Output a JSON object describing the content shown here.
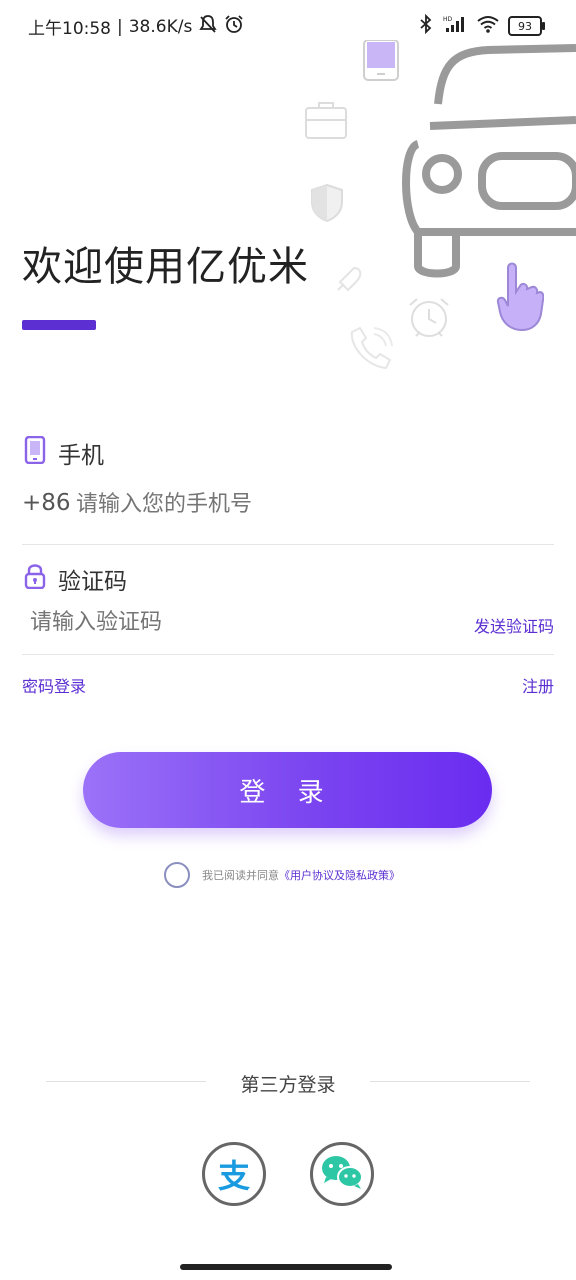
{
  "status_bar": {
    "time": "上午10:58",
    "separator": "|",
    "speed": "38.6K/s",
    "battery": "93",
    "icons": [
      "mute-bell-icon",
      "alarm-icon",
      "bluetooth-icon",
      "hd-signal-icon",
      "wifi-icon",
      "battery-icon"
    ]
  },
  "hero": {
    "welcome": "欢迎使用亿优米",
    "accent_color": "#5b2fd1"
  },
  "phone_section": {
    "label": "手机",
    "country_code": "+86",
    "placeholder": "请输入您的手机号",
    "icon": "phone-icon"
  },
  "code_section": {
    "label": "验证码",
    "placeholder": "请输入验证码",
    "send_code": "发送验证码",
    "icon": "lock-icon"
  },
  "links": {
    "password_login": "密码登录",
    "register": "注册"
  },
  "login_button": "登 录",
  "agreement": {
    "prefix": "我已阅读并同意",
    "link": "《用户协议及隐私政策》"
  },
  "third_party": {
    "title": "第三方登录",
    "providers": [
      {
        "name": "alipay",
        "glyph": "支",
        "icon": "alipay-icon",
        "color": "#1a9be0"
      },
      {
        "name": "wechat",
        "icon": "wechat-icon",
        "color": "#2ec7a5"
      }
    ]
  },
  "colors": {
    "brand": "#5b2fd1",
    "button_gradient_start": "#9b72f8",
    "button_gradient_end": "#6a2cf0"
  }
}
